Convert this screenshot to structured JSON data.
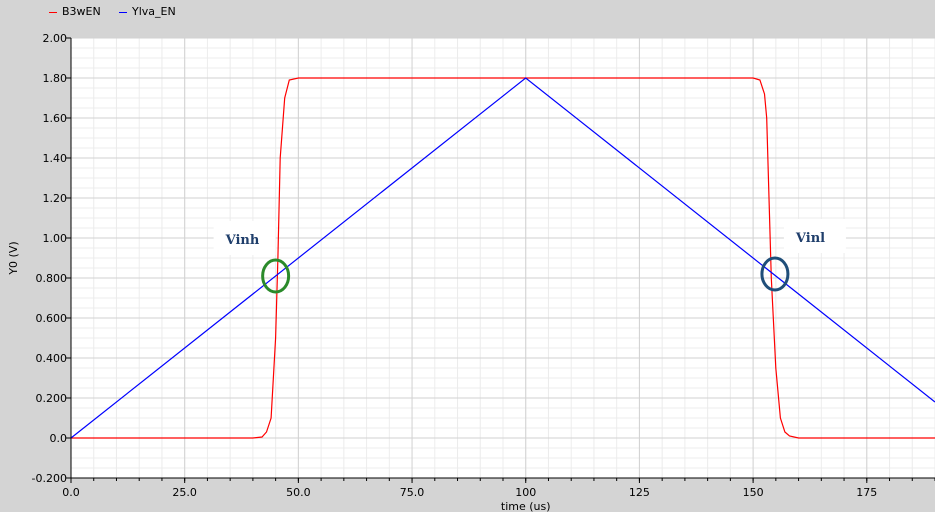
{
  "chart_data": {
    "type": "line",
    "xlabel": "time (us)",
    "ylabel": "Y0 (V)",
    "xlim": [
      0,
      190
    ],
    "ylim": [
      -0.2,
      2.0
    ],
    "grid": true,
    "legend_placement": "top-left",
    "x_ticks": [
      {
        "value": 0,
        "label": "0.0"
      },
      {
        "value": 25,
        "label": "25.0"
      },
      {
        "value": 50,
        "label": "50.0"
      },
      {
        "value": 75,
        "label": "75.0"
      },
      {
        "value": 100,
        "label": "100"
      },
      {
        "value": 125,
        "label": "125"
      },
      {
        "value": 150,
        "label": "150"
      },
      {
        "value": 175,
        "label": "175"
      }
    ],
    "y_ticks": [
      {
        "value": -0.2,
        "label": "-0.200"
      },
      {
        "value": 0.0,
        "label": "0.0"
      },
      {
        "value": 0.2,
        "label": "0.200"
      },
      {
        "value": 0.4,
        "label": "0.400"
      },
      {
        "value": 0.6,
        "label": "0.600"
      },
      {
        "value": 0.8,
        "label": "0.800"
      },
      {
        "value": 1.0,
        "label": "1.00"
      },
      {
        "value": 1.2,
        "label": "1.20"
      },
      {
        "value": 1.4,
        "label": "1.40"
      },
      {
        "value": 1.6,
        "label": "1.60"
      },
      {
        "value": 1.8,
        "label": "1.80"
      },
      {
        "value": 2.0,
        "label": "2.00"
      }
    ],
    "series": [
      {
        "name": "B3wEN",
        "color": "#ff0000",
        "x": [
          0,
          40,
          42,
          43,
          44,
          45,
          45.5,
          46,
          47,
          48,
          50,
          100,
          150,
          151.5,
          152.5,
          153,
          153.5,
          154,
          155,
          156,
          157,
          158,
          160,
          190
        ],
        "y": [
          0,
          0,
          0.005,
          0.03,
          0.1,
          0.5,
          0.9,
          1.4,
          1.7,
          1.79,
          1.8,
          1.8,
          1.8,
          1.79,
          1.72,
          1.6,
          1.2,
          0.8,
          0.35,
          0.1,
          0.03,
          0.01,
          0,
          0
        ]
      },
      {
        "name": "Ylva_EN",
        "color": "#0000ff",
        "x": [
          0,
          100,
          190
        ],
        "y": [
          0,
          1.8,
          0.18
        ]
      }
    ],
    "annotations": [
      {
        "text": "Vinh",
        "x": 45,
        "y": 0.81,
        "color": "#2a8a2a",
        "text_color": "#1f3e6b",
        "text_side": "above-left"
      },
      {
        "text": "Vinl",
        "x": 154.8,
        "y": 0.82,
        "color": "#1f4e79",
        "text_color": "#1f3e6b",
        "text_side": "above-right"
      }
    ]
  }
}
